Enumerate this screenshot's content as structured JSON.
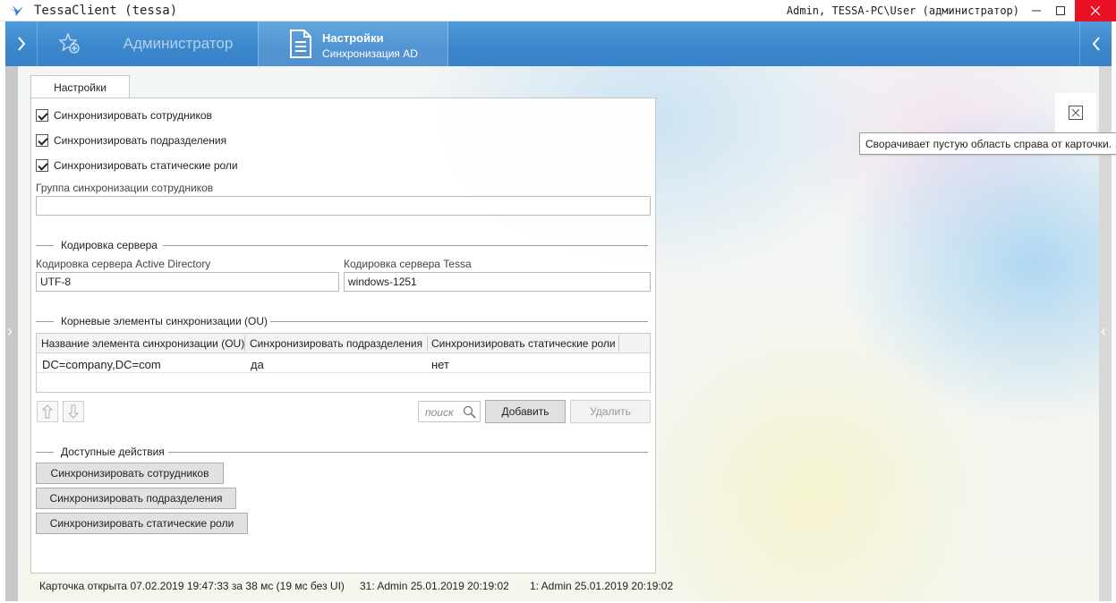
{
  "window": {
    "title": "TessaClient (tessa)",
    "user": "Admin, TESSA-PC\\User (администратор)"
  },
  "tabs": {
    "admin_label": "Администратор",
    "active_title": "Настройки",
    "active_subtitle": "Синхронизация AD"
  },
  "card": {
    "tab_label": "Настройки",
    "checkboxes": [
      {
        "label": "Синхронизировать сотрудников",
        "checked": true
      },
      {
        "label": "Синхронизировать подразделения",
        "checked": true
      },
      {
        "label": "Синхронизировать статические роли",
        "checked": true
      }
    ],
    "employee_group": {
      "label": "Группа синхронизации сотрудников",
      "value": ""
    },
    "encoding_section": "Кодировка сервера",
    "ad_encoding": {
      "label": "Кодировка сервера Active Directory",
      "value": "UTF-8"
    },
    "tessa_encoding": {
      "label": "Кодировка сервера Tessa",
      "value": "windows-1251"
    },
    "roots_section": "Корневые элементы синхронизации (OU)",
    "grid": {
      "columns": [
        "Название элемента синхронизации (OU)",
        "Синхронизировать подразделения",
        "Синхронизировать статические роли"
      ],
      "rows": [
        [
          "DC=company,DC=com",
          "да",
          "нет"
        ]
      ]
    },
    "search_placeholder": "поиск",
    "add_button": "Добавить",
    "delete_button": "Удалить",
    "actions_section": "Доступные действия",
    "actions": [
      "Синхронизировать сотрудников",
      "Синхронизировать подразделения",
      "Синхронизировать статические роли"
    ]
  },
  "tooltip": "Сворачивает пустую область справа от карточки.",
  "status": {
    "opened": "Карточка открыта 07.02.2019 19:47:33 за 38 мс (19 мс без UI)",
    "version1": "31:  Admin  25.01.2019 20:19:02",
    "version2": "1:  Admin  25.01.2019 20:19:02"
  },
  "colors": {
    "accent": "#3b86cc",
    "close": "#e81123"
  }
}
